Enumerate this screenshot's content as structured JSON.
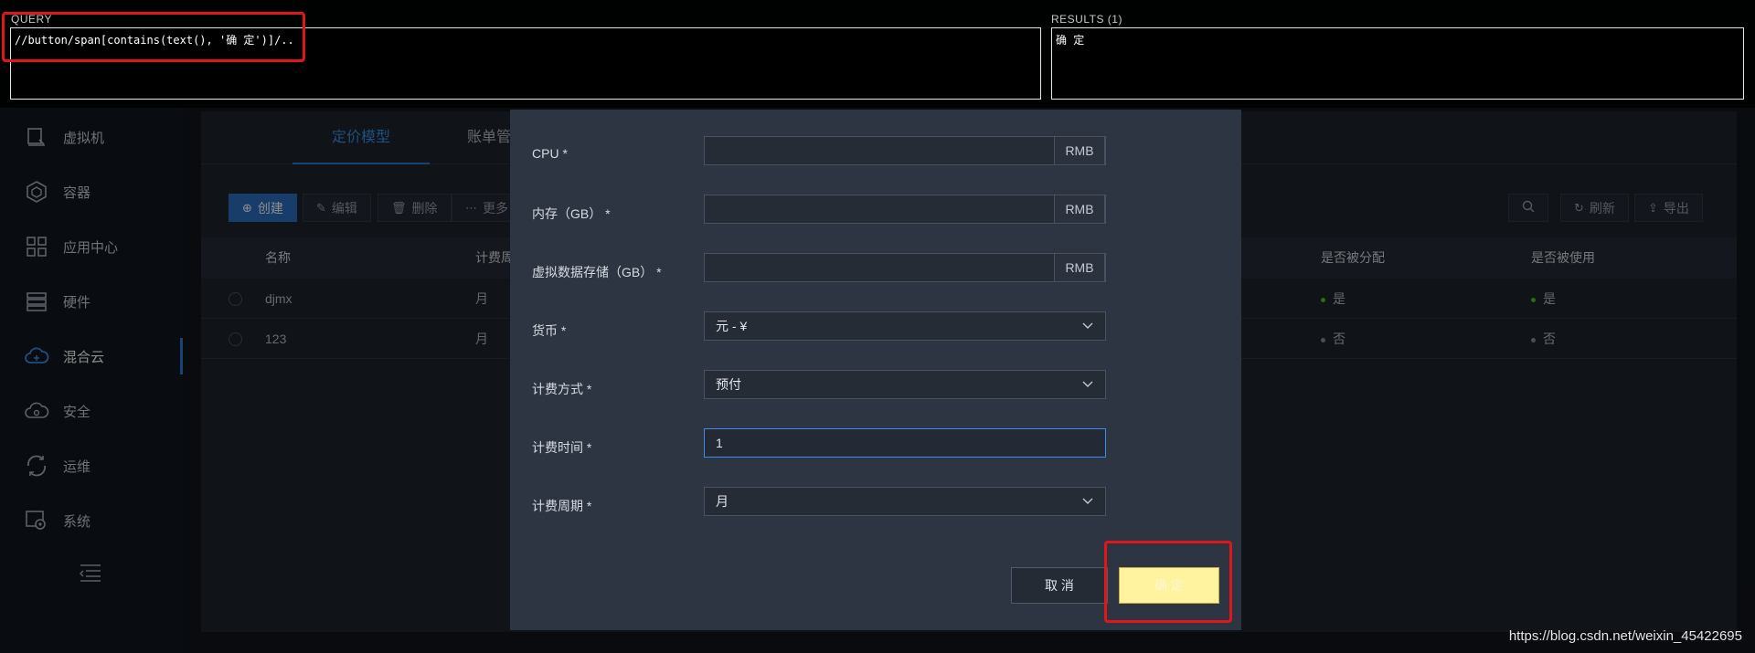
{
  "sidebar": {
    "items": [
      {
        "label": "虚拟机",
        "icon": "vm-icon"
      },
      {
        "label": "容器",
        "icon": "container-icon"
      },
      {
        "label": "应用中心",
        "icon": "app-center-icon"
      },
      {
        "label": "硬件",
        "icon": "hardware-icon"
      },
      {
        "label": "混合云",
        "icon": "cloud-icon",
        "active": true
      },
      {
        "label": "安全",
        "icon": "security-cloud-icon"
      },
      {
        "label": "运维",
        "icon": "ops-icon"
      },
      {
        "label": "系统",
        "icon": "system-gear-icon"
      }
    ],
    "collapse_icon": "menu-collapse-icon"
  },
  "tabs": [
    {
      "label": "定价模型",
      "active": true
    },
    {
      "label": "账单管"
    }
  ],
  "toolbar": {
    "create": "创建",
    "edit": "编辑",
    "delete": "删除",
    "more": "更多",
    "refresh": "刷新",
    "export": "导出"
  },
  "table": {
    "columns": [
      "名称",
      "计费周",
      "是否被分配",
      "是否被使用"
    ],
    "rows": [
      {
        "name": "djmx",
        "period": "月",
        "assigned": "是",
        "used": "是",
        "status": "yes"
      },
      {
        "name": "123",
        "period": "月",
        "assigned": "否",
        "used": "否",
        "status": "no"
      }
    ]
  },
  "modal": {
    "fields": [
      {
        "label": "CPU",
        "value": "",
        "addon": "RMB"
      },
      {
        "label": "内存（GB）",
        "value": "",
        "addon": "RMB"
      },
      {
        "label": "虚拟数据存储（GB）",
        "value": "",
        "addon": "RMB"
      },
      {
        "label": "货币",
        "value": "元 - ¥",
        "type": "select"
      },
      {
        "label": "计费方式",
        "value": "预付",
        "type": "select"
      },
      {
        "label": "计费时间",
        "value": "1",
        "type": "input",
        "focused": true
      },
      {
        "label": "计费周期",
        "value": "月",
        "type": "select"
      }
    ],
    "required_mark": "*",
    "cancel": "取 消",
    "ok": "确 定"
  },
  "query_panel": {
    "query_label": "QUERY",
    "query_text": "//button/span[contains(text(), '确 定')]/..",
    "results_label": "RESULTS (1)",
    "results_text": "确 定"
  },
  "watermark": "https://blog.csdn.net/weixin_45422695",
  "colors": {
    "accent": "#2f7ad0",
    "highlight": "#e0161b",
    "ok_button": "#fff3a0",
    "status_yes": "#52c41a",
    "status_no": "#8a8f98"
  }
}
